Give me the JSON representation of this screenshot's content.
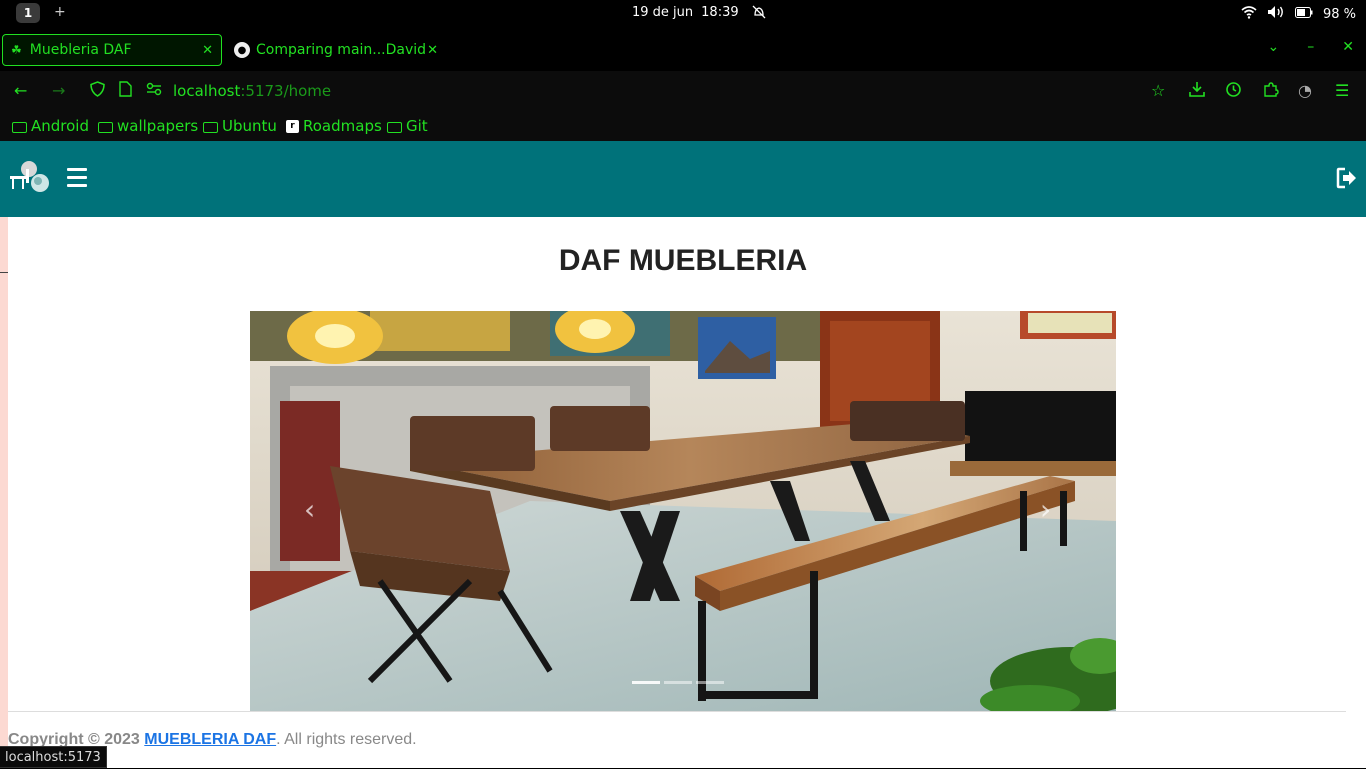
{
  "system": {
    "workspace": "1",
    "add": "+",
    "date": "19 de jun",
    "time": "18:39",
    "battery": "98 %"
  },
  "tabs": [
    {
      "title": "Muebleria DAF",
      "active": true
    },
    {
      "title": "Comparing main...David",
      "active": false
    }
  ],
  "address_bar": {
    "host": "localhost",
    "path": ":5173/home"
  },
  "bookmarks": [
    {
      "label": "Android",
      "icon": "folder-icon"
    },
    {
      "label": "wallpapers",
      "icon": "folder-icon"
    },
    {
      "label": "Ubuntu",
      "icon": "folder-icon"
    },
    {
      "label": "Roadmaps",
      "icon": "roadmap-icon"
    },
    {
      "label": "Git",
      "icon": "folder-icon"
    }
  ],
  "page": {
    "title": "DAF MUEBLERIA",
    "carousel": {
      "prev": "‹",
      "next": "›",
      "slides": 3,
      "active_slide": 1
    },
    "footer": {
      "prefix": "Copyright © 2023",
      "brand": "MUEBLERIA DAF",
      "suffix": ". All rights reserved."
    }
  },
  "status_url": "localhost:5173",
  "theme": {
    "browser_accent": "#22e022",
    "header_bg": "#00727a",
    "link": "#1b74e4"
  }
}
